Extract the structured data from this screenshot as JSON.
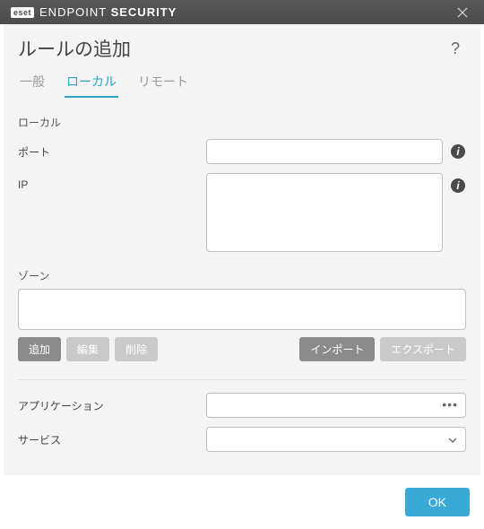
{
  "titlebar": {
    "brand_badge": "eset",
    "brand_text_light": "ENDPOINT ",
    "brand_text_bold": "SECURITY"
  },
  "page": {
    "title": "ルールの追加"
  },
  "tabs": {
    "items": [
      {
        "label": "一般",
        "active": false
      },
      {
        "label": "ローカル",
        "active": true
      },
      {
        "label": "リモート",
        "active": false
      }
    ]
  },
  "local": {
    "section_label": "ローカル",
    "port_label": "ポート",
    "port_value": "",
    "ip_label": "IP",
    "ip_value": ""
  },
  "zone": {
    "label": "ゾーン",
    "value": "",
    "buttons": {
      "add": "追加",
      "edit": "編集",
      "remove": "削除",
      "import": "インポート",
      "export": "エクスポート"
    }
  },
  "app": {
    "label": "アプリケーション",
    "value": ""
  },
  "service": {
    "label": "サービス",
    "value": ""
  },
  "footer": {
    "ok": "OK"
  }
}
